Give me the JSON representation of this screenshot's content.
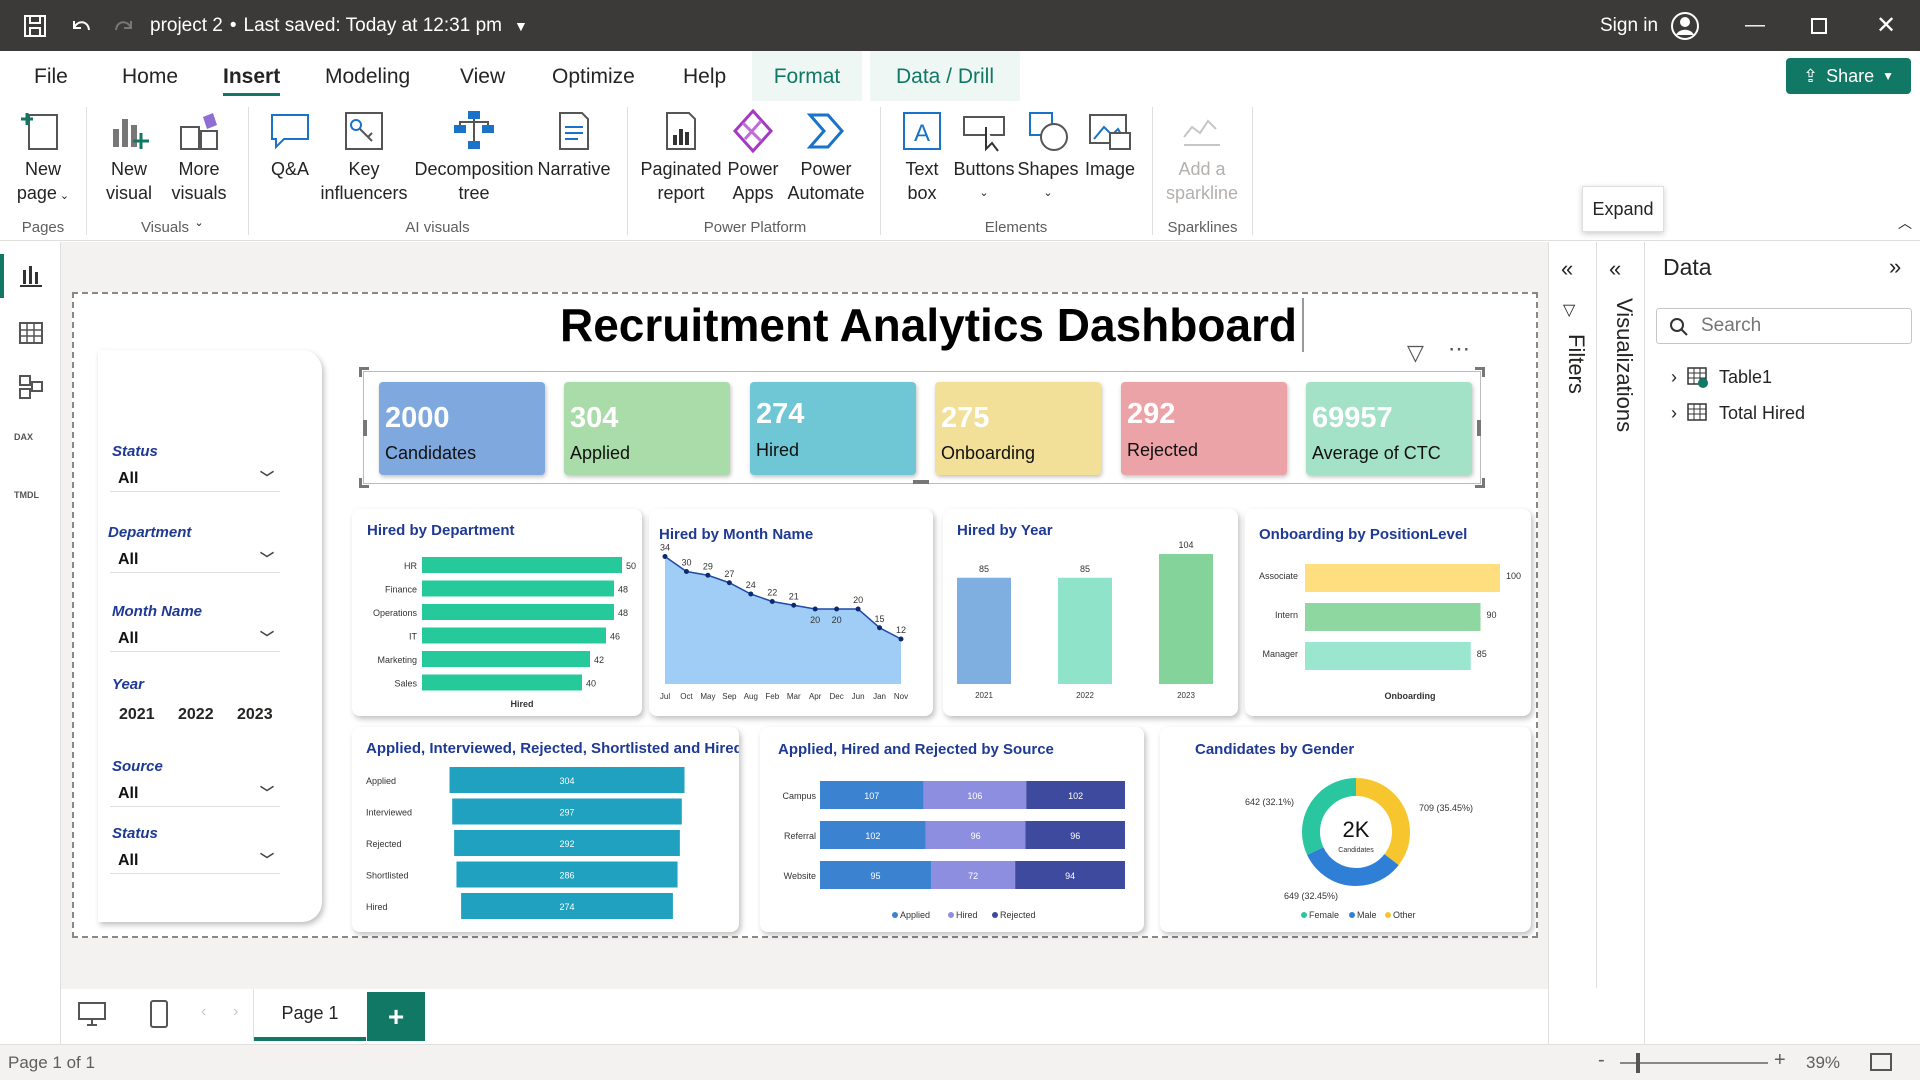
{
  "titlebar": {
    "doc": "project 2",
    "saved": "Last saved: Today at 12:31 pm",
    "signin": "Sign in"
  },
  "tabs": [
    "File",
    "Home",
    "Insert",
    "Modeling",
    "View",
    "Optimize",
    "Help",
    "Format",
    "Data / Drill"
  ],
  "share": "Share",
  "ribbon": {
    "new_page": [
      "New",
      "page"
    ],
    "new_visual": [
      "New",
      "visual"
    ],
    "more_visuals": [
      "More",
      "visuals"
    ],
    "qa": "Q&A",
    "key_influencers": [
      "Key",
      "influencers"
    ],
    "decomposition": [
      "Decomposition",
      "tree"
    ],
    "narrative": "Narrative",
    "paginated": [
      "Paginated",
      "report"
    ],
    "power_apps": [
      "Power",
      "Apps"
    ],
    "power_automate": [
      "Power",
      "Automate"
    ],
    "text_box": [
      "Text",
      "box"
    ],
    "buttons": "Buttons",
    "shapes": "Shapes",
    "image": "Image",
    "sparkline": [
      "Add a",
      "sparkline"
    ],
    "groups": {
      "pages": "Pages",
      "visuals": "Visuals",
      "ai": "AI visuals",
      "platform": "Power Platform",
      "elements": "Elements",
      "sparklines": "Sparklines"
    }
  },
  "tooltip": "Expand",
  "dashboard": {
    "title": "Recruitment Analytics Dashboard",
    "kpis": [
      {
        "value": "2000",
        "label": "Candidates",
        "color": "#7ea8de"
      },
      {
        "value": "304",
        "label": "Applied",
        "color": "#a9dca8"
      },
      {
        "value": "274",
        "label": "Hired",
        "color": "#6fc7d6"
      },
      {
        "value": "275",
        "label": "Onboarding",
        "color": "#f2df98"
      },
      {
        "value": "292",
        "label": "Rejected",
        "color": "#eba3a8"
      },
      {
        "value": "69957",
        "label": "Average of CTC",
        "color": "#a3e2c6"
      }
    ],
    "slicers": {
      "status1": {
        "label": "Status",
        "value": "All"
      },
      "department": {
        "label": "Department",
        "value": "All"
      },
      "month": {
        "label": "Month Name",
        "value": "All"
      },
      "year": {
        "label": "Year",
        "options": [
          "2021",
          "2022",
          "2023"
        ]
      },
      "source": {
        "label": "Source",
        "value": "All"
      },
      "status2": {
        "label": "Status",
        "value": "All"
      }
    }
  },
  "chart_data": [
    {
      "type": "bar",
      "title": "Hired by Department",
      "categories": [
        "HR",
        "Finance",
        "Operations",
        "IT",
        "Marketing",
        "Sales"
      ],
      "values": [
        50,
        48,
        48,
        46,
        42,
        40
      ],
      "xlabel": "Hired",
      "color": "#26c99a"
    },
    {
      "type": "area",
      "title": "Hired by Month Name",
      "categories": [
        "Jul",
        "Oct",
        "May",
        "Sep",
        "Aug",
        "Feb",
        "Mar",
        "Apr",
        "Dec",
        "Jun",
        "Jan",
        "Nov"
      ],
      "values": [
        34,
        30,
        29,
        27,
        24,
        22,
        21,
        20,
        20,
        20,
        15,
        12
      ],
      "color": "#8fc4f5"
    },
    {
      "type": "bar",
      "title": "Hired by Year",
      "categories": [
        "2021",
        "2022",
        "2023"
      ],
      "values": [
        85,
        85,
        104
      ],
      "colors": [
        "#7faee0",
        "#8ee3c8",
        "#84d39a"
      ]
    },
    {
      "type": "bar",
      "title": "Onboarding by PositionLevel",
      "categories": [
        "Associate",
        "Intern",
        "Manager"
      ],
      "values": [
        100,
        90,
        85
      ],
      "xlabel": "Onboarding",
      "colors": [
        "#ffde80",
        "#8fd7a0",
        "#9be6cf"
      ]
    },
    {
      "type": "bar",
      "title": "Applied, Interviewed, Rejected, Shortlisted and Hired",
      "categories": [
        "Applied",
        "Interviewed",
        "Rejected",
        "Shortlisted",
        "Hired"
      ],
      "values": [
        304,
        297,
        292,
        286,
        274
      ],
      "color": "#1fa1bf"
    },
    {
      "type": "bar",
      "title": "Applied, Hired and Rejected by Source",
      "categories": [
        "Campus",
        "Referral",
        "Website"
      ],
      "series": [
        {
          "name": "Applied",
          "values": [
            107,
            102,
            95
          ],
          "color": "#3b82d0"
        },
        {
          "name": "Hired",
          "values": [
            106,
            96,
            72
          ],
          "color": "#8e8ee0"
        },
        {
          "name": "Rejected",
          "values": [
            102,
            96,
            94
          ],
          "color": "#3d4a9e"
        }
      ]
    },
    {
      "type": "pie",
      "title": "Candidates by Gender",
      "center_value": "2K",
      "center_label": "Candidates",
      "slices": [
        {
          "name": "Female",
          "value": 642,
          "label": "642 (32.1%)",
          "color": "#2ac6a0"
        },
        {
          "name": "Male",
          "value": 649,
          "label": "649 (32.45%)",
          "color": "#2f7fd6"
        },
        {
          "name": "Other",
          "value": 709,
          "label": "709 (35.45%)",
          "color": "#f7c52e"
        }
      ]
    }
  ],
  "pages": {
    "tab": "Page 1",
    "status": "Page 1 of 1",
    "zoom": "39%"
  },
  "panels": {
    "filters": "Filters",
    "visualizations": "Visualizations",
    "data_title": "Data",
    "search_placeholder": "Search",
    "tables": [
      "Table1",
      "Total Hired"
    ]
  }
}
